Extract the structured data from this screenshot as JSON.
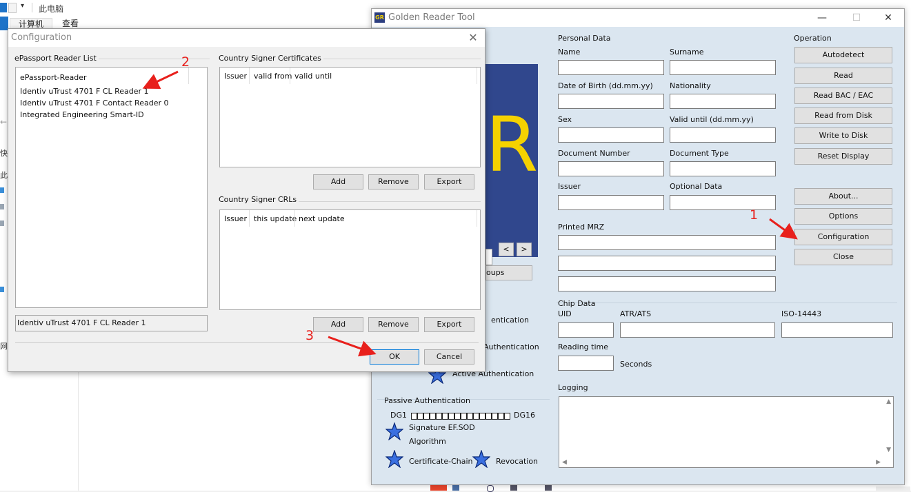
{
  "explorer": {
    "title": "此电脑",
    "tabs": [
      "计算机",
      "查看"
    ],
    "side_fragments": [
      "快",
      "此",
      "网"
    ]
  },
  "grt": {
    "title": "Golden Reader Tool",
    "personal_data": {
      "heading": "Personal Data",
      "fields": [
        "Name",
        "Surname",
        "Date of Birth (dd.mm.yy)",
        "Nationality",
        "Sex",
        "Valid until (dd.mm.yy)",
        "Document Number",
        "Document Type",
        "Issuer",
        "Optional Data"
      ],
      "printed_mrz": "Printed MRZ"
    },
    "operation": {
      "heading": "Operation",
      "buttons": [
        "Autodetect",
        "Read",
        "Read BAC / EAC",
        "Read from Disk",
        "Write to Disk",
        "Reset Display",
        "About...",
        "Options",
        "Configuration",
        "Close"
      ]
    },
    "nav": {
      "prev": "<",
      "next": ">",
      "groups_button": "oups"
    },
    "auth_partial": [
      "entication",
      "Authentication"
    ],
    "active_auth": "Active Authentication",
    "chip": {
      "heading": "Chip Data",
      "uid": "UID",
      "atr": "ATR/ATS",
      "iso": "ISO-14443",
      "reading_time": "Reading time",
      "seconds": "Seconds"
    },
    "logging": "Logging",
    "passive": {
      "heading": "Passive Authentication",
      "dg_start": "DG1",
      "dg_end": "DG16",
      "dg_boxes": 16,
      "signature": "Signature EF.SOD",
      "algorithm": "Algorithm",
      "cert_chain": "Certificate-Chain",
      "revocation": "Revocation"
    }
  },
  "config": {
    "title": "Configuration",
    "reader_list": {
      "heading": "ePassport Reader List",
      "items": [
        "ePassport-Reader",
        "Identiv uTrust 4701 F CL Reader 1",
        "Identiv uTrust 4701 F Contact Reader 0",
        "Integrated Engineering Smart-ID"
      ],
      "selected_value": "Identiv uTrust 4701 F CL Reader 1"
    },
    "csca": {
      "heading": "Country Signer Certificates",
      "columns": [
        "Issuer",
        "valid from",
        "valid until"
      ],
      "buttons": [
        "Add",
        "Remove",
        "Export"
      ]
    },
    "crl": {
      "heading": "Country Signer CRLs",
      "columns": [
        "Issuer",
        "this update",
        "next update"
      ],
      "buttons": [
        "Add",
        "Remove",
        "Export"
      ]
    },
    "ok": "OK",
    "cancel": "Cancel"
  },
  "annotations": [
    "1",
    "2",
    "3"
  ],
  "colors": {
    "annotation": "#e8201c",
    "logo_bg": "#30478d",
    "logo_fg": "#f5d200",
    "window_bg": "#dbe6f0"
  }
}
